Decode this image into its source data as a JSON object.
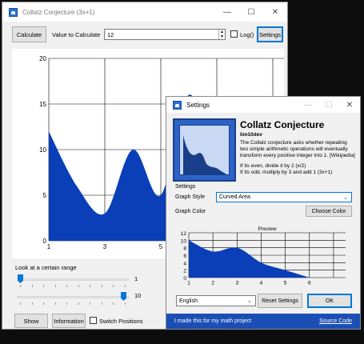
{
  "main": {
    "title": "Collatz Conjecture (3x+1)",
    "calculate_label": "Calculate",
    "value_label": "Value to Calculate",
    "value": "12",
    "log_label": "Log()",
    "settings_label": "Settings",
    "range_label": "Look at a certain range",
    "range_start": "1",
    "range_end": "10",
    "show_label": "Show",
    "information_label": "Information",
    "switch_label": "Switch Positions"
  },
  "settings": {
    "title": "Settings",
    "heading": "Collatz Conjecture",
    "author": "lim10dev",
    "desc_1": "The Collatz conjecture asks whether repeating",
    "desc_2": "two simple arithmetic operations will eventually",
    "desc_3": "transform every positive integer into 1. [Wikipedia]",
    "rule_even": "If its even, divide it by 2 (x/2)",
    "rule_odd": "If its odd, multiply by 3 and add 1 (3x+1)",
    "group_label": "Settings",
    "graph_style_label": "Graph Style",
    "graph_style_value": "Curved Area",
    "graph_color_label": "Graph Color",
    "choose_color_label": "Choose Color",
    "language_value": "English",
    "reset_label": "Reset Settings",
    "ok_label": "OK",
    "footer_text": "I made this for my math project",
    "source_code_label": "Source Code"
  },
  "colors": {
    "graph_fill": "#0a3fb8",
    "footer_bg": "#1c4fb5",
    "accent": "#0078d7"
  },
  "chart_data": [
    {
      "type": "area",
      "title": "",
      "x": [
        1,
        2,
        3,
        4,
        5,
        6,
        7,
        8,
        9,
        10
      ],
      "y": [
        12,
        6,
        3,
        10,
        5,
        16,
        8,
        4,
        2,
        1
      ],
      "x_ticks": [
        "1",
        "3",
        "5"
      ],
      "y_ticks": [
        "0",
        "5",
        "10",
        "15",
        "20"
      ],
      "ylim": [
        0,
        20
      ],
      "grid": true
    },
    {
      "type": "area",
      "title": "Preview",
      "x": [
        1,
        2,
        3,
        4,
        5,
        6
      ],
      "y": [
        10,
        7,
        8,
        4,
        2,
        0
      ],
      "x_ticks": [
        "1",
        "2",
        "3",
        "4",
        "5",
        "6"
      ],
      "y_ticks": [
        "0",
        "2",
        "4",
        "6",
        "8",
        "10",
        "12"
      ],
      "ylim": [
        0,
        12
      ],
      "grid": true
    }
  ]
}
